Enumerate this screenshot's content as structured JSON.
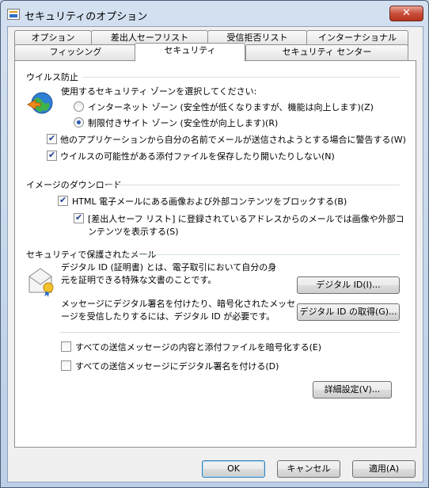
{
  "window": {
    "title": "セキュリティのオプション",
    "close_glyph": "✕"
  },
  "tabs": {
    "row1": [
      "オプション",
      "差出人セーフリスト",
      "受信拒否リスト",
      "インターナショナル"
    ],
    "row2": [
      "フィッシング",
      "セキュリティ",
      "セキュリティ センター"
    ],
    "selected": "セキュリティ"
  },
  "virus": {
    "title": "ウイルス防止",
    "zone_prompt": "使用するセキュリティ ゾーンを選択してください:",
    "internet_zone": "インターネット ゾーン (安全性が低くなりますが、機能は向上します)(Z)",
    "restricted_zone": "制限付きサイト ゾーン (安全性が向上します)(R)",
    "selected_zone": "restricted",
    "warn_send": {
      "label": "他のアプリケーションから自分の名前でメールが送信されようとする場合に警告する(W)",
      "checked": true
    },
    "block_attach": {
      "label": "ウイルスの可能性がある添付ファイルを保存したり開いたりしない(N)",
      "checked": true
    }
  },
  "images": {
    "title": "イメージのダウンロード",
    "block_html": {
      "label": "HTML 電子メールにある画像および外部コンテンツをブロックする(B)",
      "checked": true
    },
    "safe_list": {
      "label_line1": "[差出人セーフ リスト] に登録されているアドレスからのメールでは画像や外部コ",
      "label_line2": "ンテンツを表示する(S)",
      "checked": true
    }
  },
  "secure_mail": {
    "title": "セキュリティで保護されたメール",
    "digital_id_desc_line1": "デジタル ID (証明書) とは、電子取引において自分の身",
    "digital_id_desc_line2": "元を証明できる特殊な文書のことです。",
    "digital_id_button": "デジタル ID(I)...",
    "sign_desc_line1": "メッセージにデジタル署名を付けたり、暗号化されたメッセ",
    "sign_desc_line2": "ージを受信したりするには、デジタル ID が必要です。",
    "get_id_button": "デジタル ID の取得(G)...",
    "encrypt_all": {
      "label": "すべての送信メッセージの内容と添付ファイルを暗号化する(E)",
      "checked": false
    },
    "sign_all": {
      "label": "すべての送信メッセージにデジタル署名を付ける(D)",
      "checked": false
    },
    "advanced_button": "詳細設定(V)..."
  },
  "footer": {
    "ok": "OK",
    "cancel": "キャンセル",
    "apply": "適用(A)"
  },
  "icons": {
    "window": "mail-options-icon",
    "virus": "globe-shield-icon",
    "mail": "certificate-envelope-icon"
  }
}
